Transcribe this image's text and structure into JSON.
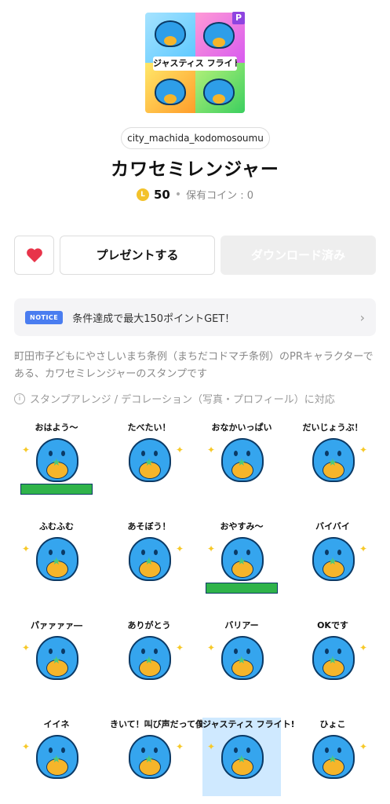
{
  "package": {
    "author": "city_machida_kodomosoumu",
    "title": "カワセミレンジャー",
    "premium_badge": "P",
    "hero_banner": "ジャスティス フライト!!",
    "coin_symbol": "L",
    "price": "50",
    "separator": "•",
    "owned_coins": "保有コイン : 0"
  },
  "actions": {
    "favorite_icon": "heart-icon",
    "gift_label": "プレゼントする",
    "download_label": "ダウンロード済み"
  },
  "notice": {
    "tag": "NOTICE",
    "text": "条件達成で最大150ポイントGET！",
    "chevron": "›"
  },
  "description": "町田市子どもにやさしいまち条例（まちだコドマチ条例）のPRキャラクターである、カワセミレンジャーのスタンプです",
  "feature": {
    "info_icon": "i",
    "text": "スタンプアレンジ / デコレーション（写真・プロフィール）に対応"
  },
  "stickers": [
    {
      "caption": "おはよう～",
      "bg": "#ffffff"
    },
    {
      "caption": "たべたい！",
      "bg": "#ffffff"
    },
    {
      "caption": "おなかいっぱい",
      "bg": "#ffffff"
    },
    {
      "caption": "だいじょうぶ！",
      "bg": "#ffffff"
    },
    {
      "caption": "ふむふむ",
      "bg": "#ffffff"
    },
    {
      "caption": "あそぼう！",
      "bg": "#ffffff"
    },
    {
      "caption": "おやすみ～",
      "bg": "#ffffff"
    },
    {
      "caption": "バイバイ",
      "bg": "#ffffff"
    },
    {
      "caption": "パァァァァ―",
      "bg": "#ffffff"
    },
    {
      "caption": "ありがとう",
      "bg": "#ffffff"
    },
    {
      "caption": "バリアー",
      "bg": "#ffffff"
    },
    {
      "caption": "OKです",
      "bg": "#ffffff"
    },
    {
      "caption": "イイネ",
      "bg": "#ffffff"
    },
    {
      "caption": "きいて！叫び声だって僕たちの意見",
      "bg": "#ffffff"
    },
    {
      "caption": "ジャスティス フライト!!",
      "bg": "#cfe9ff"
    },
    {
      "caption": "ひょこ",
      "bg": "#ffffff"
    }
  ]
}
